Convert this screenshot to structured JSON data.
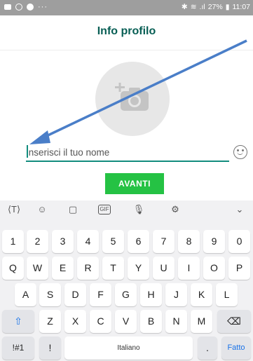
{
  "status_bar": {
    "dots": "···",
    "battery": "27%",
    "time": "11:07"
  },
  "header": {
    "title": "Info profilo"
  },
  "profile": {
    "photo_icon": "add-photo-camera-icon"
  },
  "name_field": {
    "placeholder": "Inserisci il tuo nome",
    "value": ""
  },
  "emoji_icon": "emoji-smile-icon",
  "next_button": {
    "label": "AVANTI"
  },
  "annotation": {
    "arrow_color": "#4a7ec8",
    "meaning": "arrow points to name field"
  },
  "keyboard": {
    "toolbar": [
      "text-style-icon",
      "emoji-icon",
      "sticker-icon",
      "gif-icon",
      "microphone-icon",
      "settings-icon",
      "collapse-icon"
    ],
    "gif_label": "GIF",
    "number_row": [
      "1",
      "2",
      "3",
      "4",
      "5",
      "6",
      "7",
      "8",
      "9",
      "0"
    ],
    "row1": [
      "Q",
      "W",
      "E",
      "R",
      "T",
      "Y",
      "U",
      "I",
      "O",
      "P"
    ],
    "row2": [
      "A",
      "S",
      "D",
      "F",
      "G",
      "H",
      "J",
      "K",
      "L"
    ],
    "row3": [
      "Z",
      "X",
      "C",
      "V",
      "B",
      "N",
      "M"
    ],
    "symbols_key": "!#1",
    "exclamation_key": "!",
    "space_label": "Italiano",
    "period_key": ".",
    "enter_key": "Fatto"
  },
  "colors": {
    "accent": "#075e54",
    "input_underline": "#128c7e",
    "button": "#25c244",
    "status_bar": "#9e9e9e",
    "enter_text": "#1a73e8"
  }
}
